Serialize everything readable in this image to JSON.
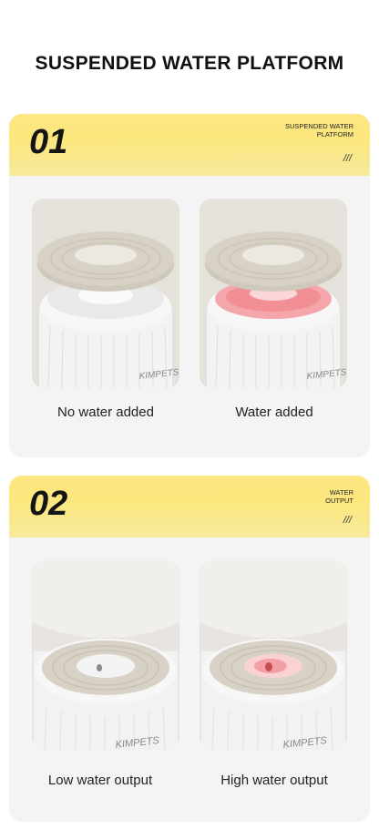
{
  "page": {
    "title": "SUSPENDED WATER PLATFORM"
  },
  "sections": [
    {
      "number": "01",
      "tag_line1": "SUSPENDED WATER",
      "tag_line2": "PLATFORM",
      "marker": "///",
      "items": [
        {
          "caption": "No water added",
          "brand": "KIMPETS"
        },
        {
          "caption": "Water added",
          "brand": "KIMPETS"
        }
      ]
    },
    {
      "number": "02",
      "tag_line1": "WATER",
      "tag_line2": "OUTPUT",
      "marker": "///",
      "items": [
        {
          "caption": "Low water output",
          "brand": "KIMPETS"
        },
        {
          "caption": "High water output",
          "brand": "KIMPETS"
        }
      ]
    }
  ],
  "colors": {
    "band_yellow": "#fbe77e",
    "card_bg": "#f4f4f4",
    "ring_beige": "#d6d0c4",
    "water_pink": "#f08a90"
  }
}
